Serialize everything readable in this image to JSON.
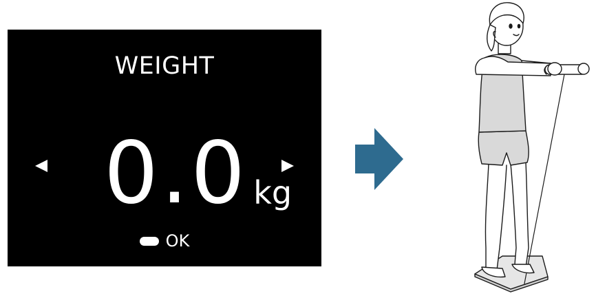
{
  "screen": {
    "title": "WEIGHT",
    "value": "0.0",
    "unit": "kg",
    "ok_label": "OK",
    "left_nav_icon": "triangle-left-icon",
    "right_nav_icon": "triangle-right-icon",
    "ok_button_icon": "pill-button-icon"
  },
  "flow_arrow": {
    "icon": "arrow-right-icon",
    "color": "#2e6b8f"
  },
  "illustration": {
    "subject": "person-standing-on-scale-holding-handle",
    "skin_color": "#ffffff",
    "clothing_color": "#d9d9d9",
    "line_color": "#1a1a1a"
  },
  "colors": {
    "screen_background": "#000000",
    "screen_text": "#ffffff",
    "page_background": "#ffffff"
  }
}
